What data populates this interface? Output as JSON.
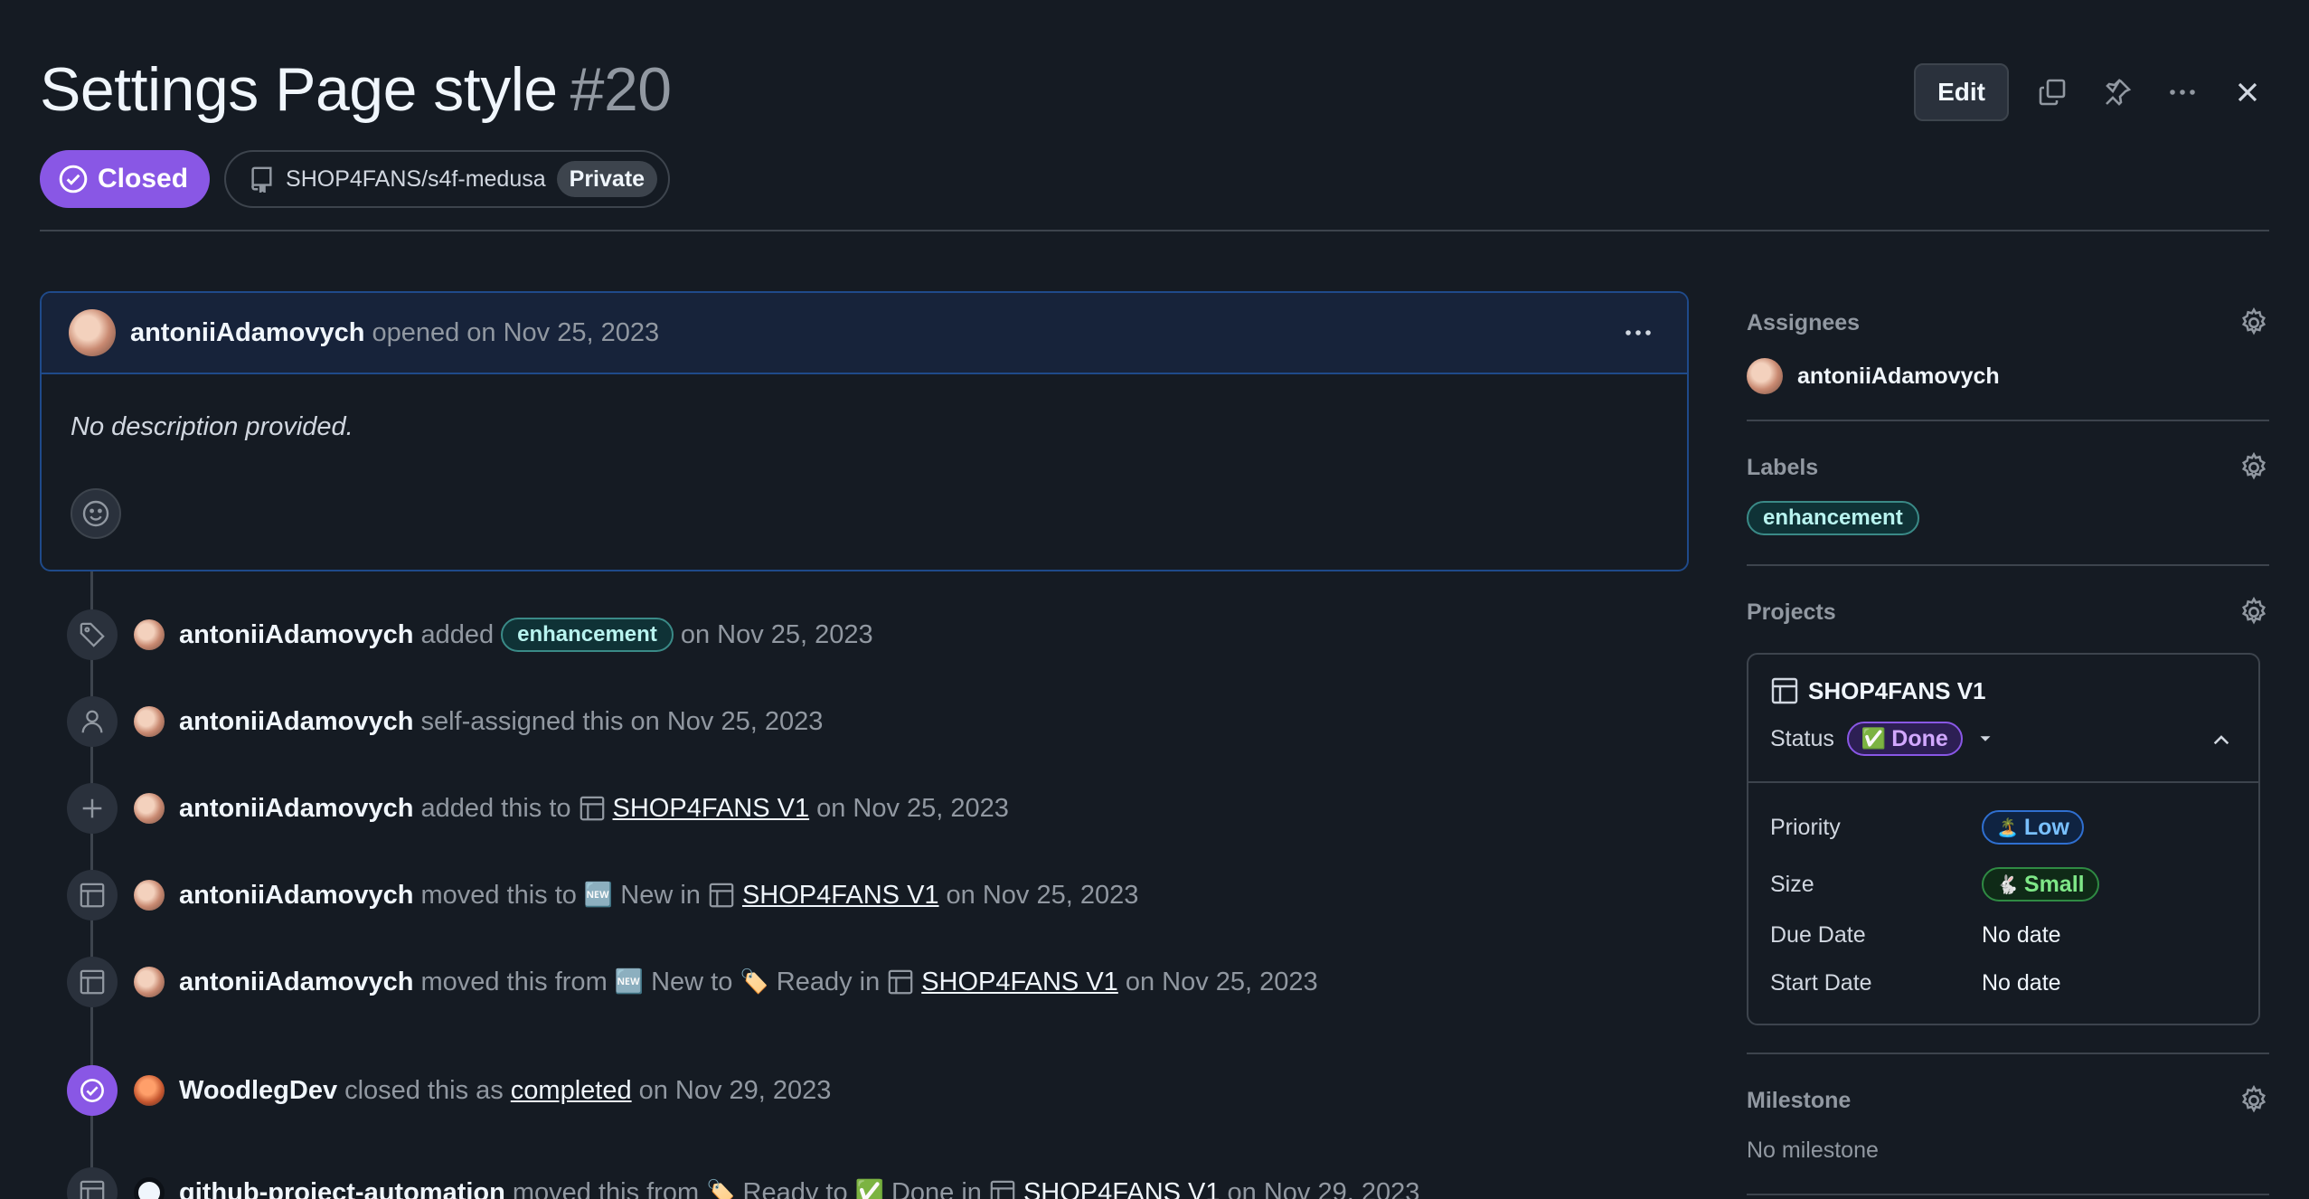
{
  "issue": {
    "title": "Settings Page style",
    "number": "#20",
    "state": "Closed",
    "repo": "SHOP4FANS/s4f-medusa",
    "visibility": "Private"
  },
  "header": {
    "edit_label": "Edit"
  },
  "comment": {
    "author": "antoniiAdamovych",
    "meta": "opened on Nov 25, 2023",
    "body": "No description provided."
  },
  "timeline": [
    {
      "icon": "tag-icon",
      "actor": "antoniiAdamovych",
      "parts": [
        "added"
      ],
      "label": "enhancement",
      "after": "on Nov 25, 2023"
    },
    {
      "icon": "person-icon",
      "actor": "antoniiAdamovych",
      "text": "self-assigned this on Nov 25, 2023"
    },
    {
      "icon": "plus-icon",
      "actor": "antoniiAdamovych",
      "before": "added this to",
      "project": "SHOP4FANS V1",
      "after": "on Nov 25, 2023"
    },
    {
      "icon": "table-icon",
      "actor": "antoniiAdamovych",
      "before": "moved this to",
      "emoji1": "🆕",
      "mid": "New in",
      "project": "SHOP4FANS V1",
      "after": "on Nov 25, 2023"
    },
    {
      "icon": "table-icon",
      "actor": "antoniiAdamovych",
      "before": "moved this from",
      "emoji1": "🆕",
      "mid1": "New to",
      "emoji2": "🏷️",
      "mid2": "Ready in",
      "project": "SHOP4FANS V1",
      "after": "on Nov 25, 2023"
    },
    {
      "icon": "check-circle-icon",
      "actor": "WoodlegDev",
      "before": "closed this as",
      "link": "completed",
      "after": "on Nov 29, 2023"
    },
    {
      "icon": "table-icon",
      "actor": "github-project-automation",
      "before": "moved this from",
      "emoji1": "🏷️",
      "mid1": "Ready to",
      "emoji2": "✅",
      "mid2": "Done in",
      "project": "SHOP4FANS V1",
      "after": "on Nov 29, 2023"
    }
  ],
  "sidebar": {
    "assignees": {
      "heading": "Assignees",
      "user": "antoniiAdamovych"
    },
    "labels": {
      "heading": "Labels",
      "label": "enhancement"
    },
    "projects": {
      "heading": "Projects",
      "name": "SHOP4FANS V1",
      "status_key": "Status",
      "status_value": "Done",
      "status_emoji": "✅",
      "fields": [
        {
          "key": "Priority",
          "value": "Low",
          "emoji": "🏝️"
        },
        {
          "key": "Size",
          "value": "Small",
          "emoji": "🐇"
        },
        {
          "key": "Due Date",
          "value": "No date"
        },
        {
          "key": "Start Date",
          "value": "No date"
        }
      ]
    },
    "milestone": {
      "heading": "Milestone",
      "value": "No milestone"
    }
  },
  "colors": {
    "closed": "#8957e5",
    "background": "#151b23",
    "label_bg": "#0f3236"
  }
}
